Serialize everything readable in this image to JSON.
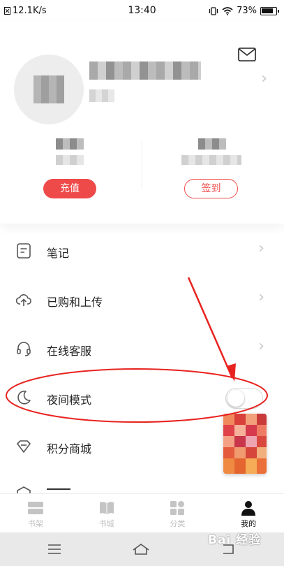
{
  "status_bar": {
    "network_speed": "12.1K/s",
    "time": "13:40",
    "battery": "73%"
  },
  "profile": {
    "recharge_label": "充值",
    "signin_label": "签到"
  },
  "menu": {
    "items": [
      {
        "label": "笔记",
        "icon": "note-icon"
      },
      {
        "label": "已购和上传",
        "icon": "cloud-upload-icon"
      },
      {
        "label": "在线客服",
        "icon": "headset-icon"
      },
      {
        "label": "夜间模式",
        "icon": "moon-icon",
        "toggle_on": false
      },
      {
        "label": "积分商城",
        "icon": "diamond-icon"
      }
    ]
  },
  "tabs": [
    {
      "label": "书架",
      "icon": "bookshelf-icon"
    },
    {
      "label": "书城",
      "icon": "book-icon"
    },
    {
      "label": "分类",
      "icon": "category-icon"
    },
    {
      "label": "我的",
      "icon": "person-icon",
      "active": true
    }
  ],
  "watermark": "Bai 经验",
  "colors": {
    "accent": "#ef4a4a",
    "annotation": "#e8231f"
  }
}
